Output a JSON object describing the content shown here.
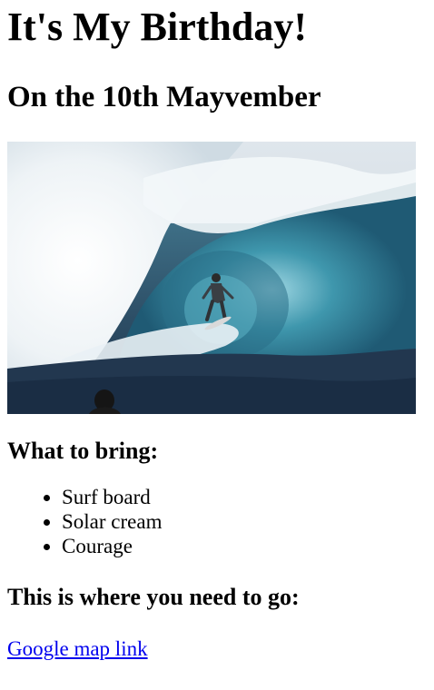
{
  "heading": "It's My Birthday!",
  "date_heading": "On the 10th Mayvember",
  "hero_image": {
    "subject": "surfer-inside-wave-barrel-photo"
  },
  "bring_section": {
    "heading": "What to bring:",
    "items": [
      "Surf board",
      "Solar cream",
      "Courage"
    ]
  },
  "location_section": {
    "heading": "This is where you need to go:",
    "link_label": "Google map link"
  },
  "colors": {
    "link": "#0000ee",
    "text": "#000000",
    "background": "#ffffff"
  }
}
